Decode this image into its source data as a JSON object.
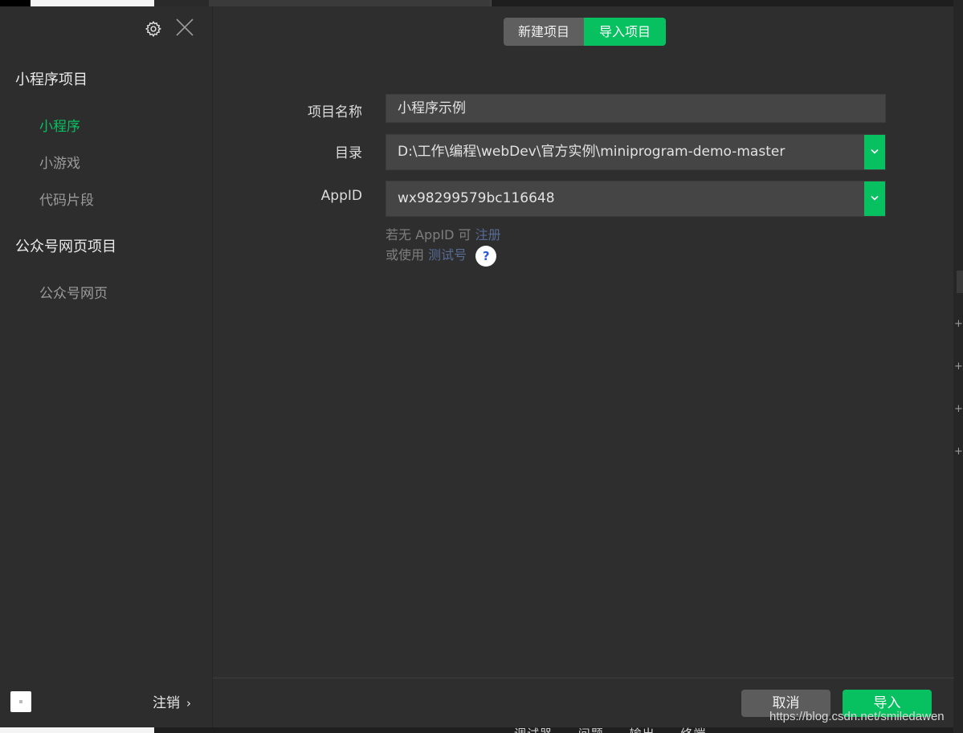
{
  "sidebar": {
    "section1_title": "小程序项目",
    "items1": [
      {
        "label": "小程序"
      },
      {
        "label": "小游戏"
      },
      {
        "label": "代码片段"
      }
    ],
    "section2_title": "公众号网页项目",
    "items2": [
      {
        "label": "公众号网页"
      }
    ],
    "logout_label": "注销",
    "logout_chevron": "›"
  },
  "tabs": [
    {
      "label": "新建项目",
      "active": false
    },
    {
      "label": "导入项目",
      "active": true
    }
  ],
  "form": {
    "name_label": "项目名称",
    "name_value": "小程序示例",
    "dir_label": "目录",
    "dir_value": "D:\\工作\\编程\\webDev\\官方实例\\miniprogram-demo-master",
    "appid_label": "AppID",
    "appid_value": "wx98299579bc116648",
    "hint1_prefix": "若无 AppID 可",
    "hint1_link": "注册",
    "hint2_prefix": "或使用",
    "hint2_link": "测试号",
    "help_glyph": "?"
  },
  "footer": {
    "cancel_label": "取消",
    "import_label": "导入"
  },
  "background": {
    "bottom_tabs": [
      "调试器",
      "问题",
      "输出",
      "终端"
    ],
    "plus_glyph": "+"
  },
  "watermark": "https://blog.csdn.net/smiledawen",
  "colors": {
    "accent": "#07c160",
    "link": "#576b95",
    "panel": "#2d2d2d"
  },
  "icons": [
    "gear-icon",
    "close-icon",
    "chevron-down-icon",
    "help-icon",
    "chevron-right-icon"
  ]
}
